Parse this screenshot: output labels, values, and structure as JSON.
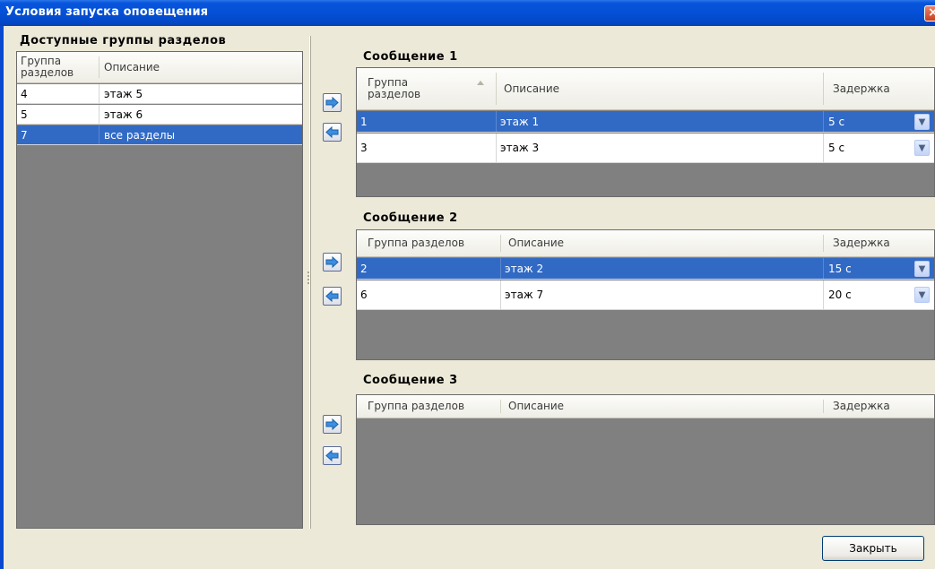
{
  "window": {
    "title": "Условия запуска оповещения"
  },
  "available": {
    "title": "Доступные группы разделов",
    "headers": {
      "group": "Группа\nразделов",
      "desc": "Описание"
    },
    "rows": [
      {
        "group": "4",
        "desc": "этаж 5",
        "selected": false
      },
      {
        "group": "5",
        "desc": "этаж 6",
        "selected": false
      },
      {
        "group": "7",
        "desc": "все разделы",
        "selected": true
      }
    ]
  },
  "messages": [
    {
      "title": "Сообщение 1",
      "headers": {
        "group": "Группа\nразделов",
        "desc": "Описание",
        "delay": "Задержка"
      },
      "rows": [
        {
          "group": "1",
          "desc": "этаж 1",
          "delay": "5 с",
          "selected": true
        },
        {
          "group": "3",
          "desc": "этаж 3",
          "delay": "5 с",
          "selected": false
        }
      ]
    },
    {
      "title": "Сообщение 2",
      "headers": {
        "group": "Группа разделов",
        "desc": "Описание",
        "delay": "Задержка"
      },
      "rows": [
        {
          "group": "2",
          "desc": "этаж 2",
          "delay": "15 с",
          "selected": true
        },
        {
          "group": "6",
          "desc": "этаж 7",
          "delay": "20 с",
          "selected": false
        }
      ]
    },
    {
      "title": "Сообщение 3",
      "headers": {
        "group": "Группа разделов",
        "desc": "Описание",
        "delay": "Задержка"
      },
      "rows": []
    }
  ],
  "icons": {
    "add": "arrow-right-icon",
    "remove": "arrow-left-icon",
    "dropdown": "chevron-down-icon",
    "close": "close-icon"
  },
  "colors": {
    "selection": "#316ac5",
    "grid_bg": "#808080",
    "titlebar": "#0450d6"
  },
  "buttons": {
    "close_label": "Закрыть",
    "dropdown_glyph": "▼"
  }
}
